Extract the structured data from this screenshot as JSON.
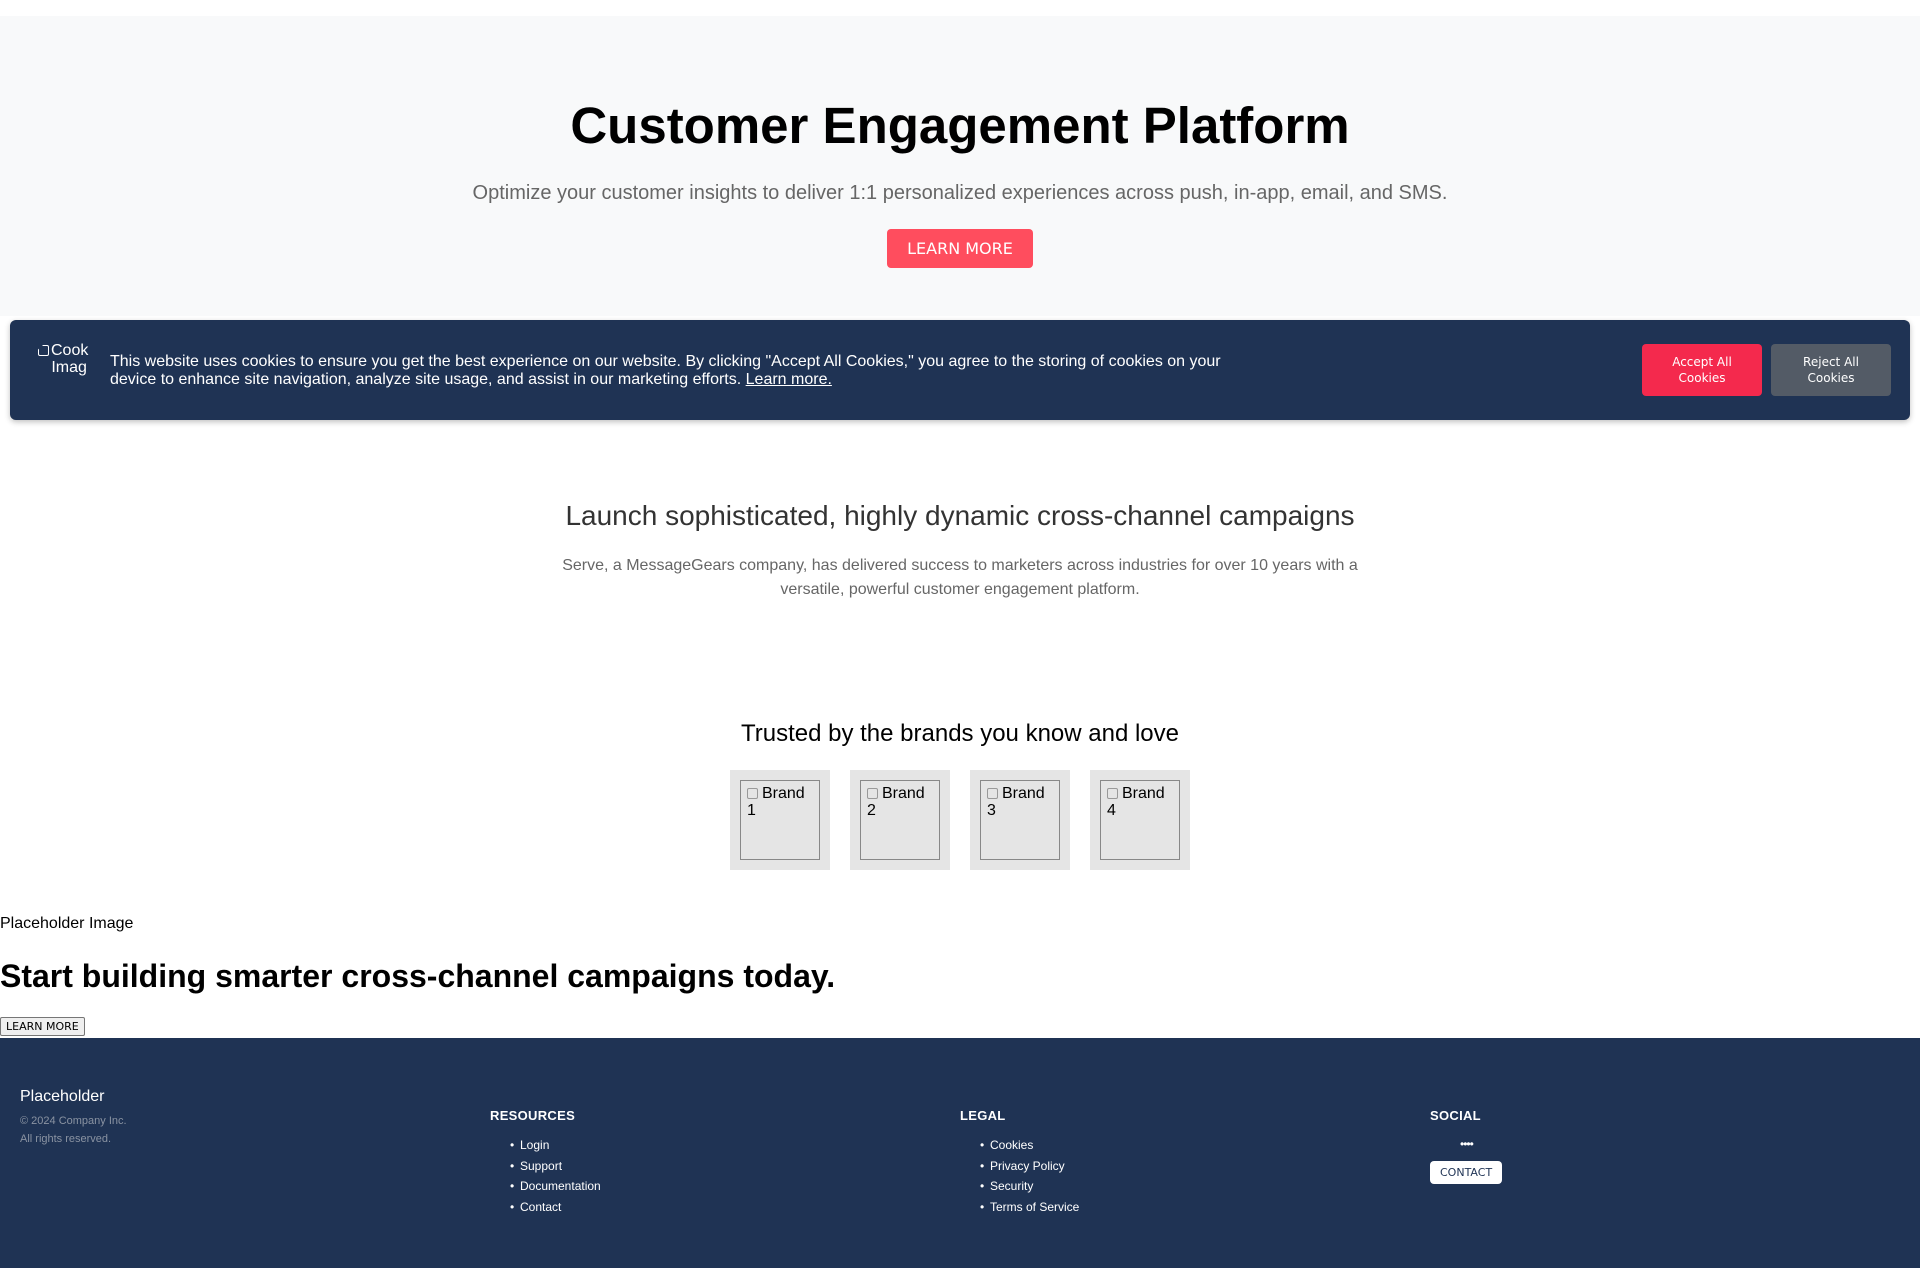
{
  "hero": {
    "title": "Customer Engagement Platform",
    "subtitle": "Optimize your customer insights to deliver 1:1 personalized experiences across push, in-app, email, and SMS.",
    "button_label": "LEARN MORE"
  },
  "cookie_banner": {
    "logo_alt_line1": "Cook",
    "logo_alt_line2": "Imag",
    "message": "This website uses cookies to ensure you get the best experience on our website. By clicking \"Accept All Cookies,\" you agree to the storing of cookies on your device to enhance site navigation, analyze site usage, and assist in our marketing efforts.",
    "learn_more": "Learn more.",
    "accept_label": "Accept All Cookies",
    "reject_label": "Reject All Cookies",
    "accept_color": "#f4294d",
    "reject_color": "#535b66"
  },
  "launch": {
    "heading": "Launch sophisticated, highly dynamic cross-channel campaigns",
    "body": "Serve, a MessageGears company, has delivered success to marketers across industries for over 10 years with a versatile, powerful customer engagement platform."
  },
  "brands": {
    "heading": "Trusted by the brands you know and love",
    "items": [
      "Brand 1",
      "Brand 2",
      "Brand 3",
      "Brand 4"
    ]
  },
  "cta": {
    "placeholder_image": "Placeholder Image",
    "heading": "Start building smarter cross-channel campaigns today.",
    "button_label": "LEARN MORE"
  },
  "footer": {
    "brand_name": "Placeholder",
    "copyright": "© 2024 Company Inc.",
    "rights": "All rights reserved.",
    "resources": {
      "heading": "RESOURCES",
      "links": [
        "Login",
        "Support",
        "Documentation",
        "Contact"
      ]
    },
    "legal": {
      "heading": "LEGAL",
      "links": [
        "Cookies",
        "Privacy Policy",
        "Security",
        "Terms of Service"
      ]
    },
    "social": {
      "heading": "SOCIAL",
      "icons": "••••",
      "contact_label": "CONTACT"
    },
    "background_color": "#1f3354"
  }
}
